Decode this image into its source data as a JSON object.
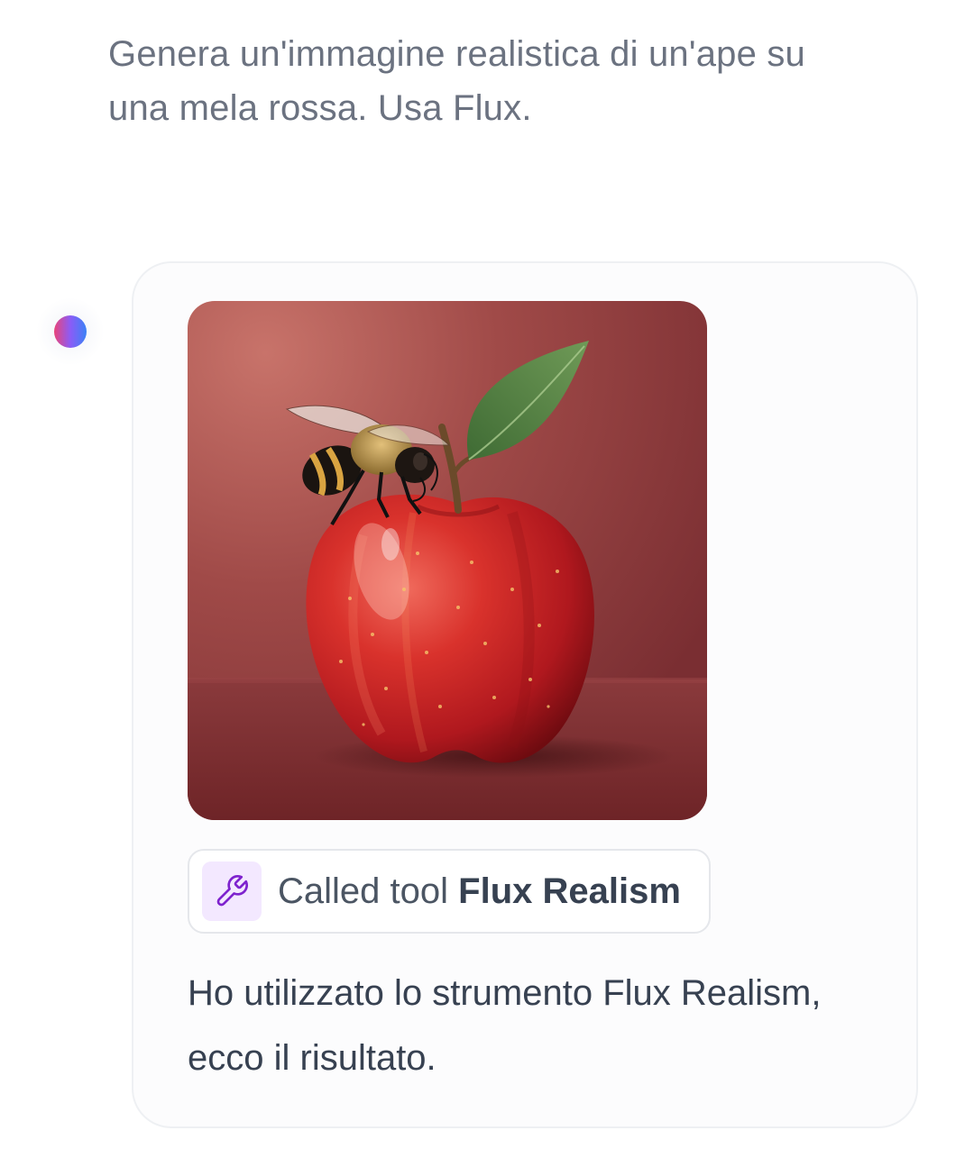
{
  "user_message": {
    "text": "Genera un'immagine realistica di un'ape su una mela rossa. Usa Flux."
  },
  "assistant": {
    "avatar_icon": "assistant-avatar-gradient-dot",
    "image": {
      "description_icon": "generated-image-bee-on-red-apple"
    },
    "tool_call": {
      "icon": "wrench-icon",
      "prefix": "Called tool",
      "tool_name": "Flux Realism"
    },
    "response_text": "Ho utilizzato lo strumento Flux Realism, ecco il risultato."
  },
  "colors": {
    "user_text": "#6b7280",
    "response_text": "#374151",
    "card_border": "#eef0f3",
    "tool_icon_bg": "#f3e8ff",
    "tool_icon_stroke": "#7e22ce",
    "avatar_gradient": [
      "#e9447a",
      "#8b5cf6",
      "#3b82f6"
    ]
  }
}
